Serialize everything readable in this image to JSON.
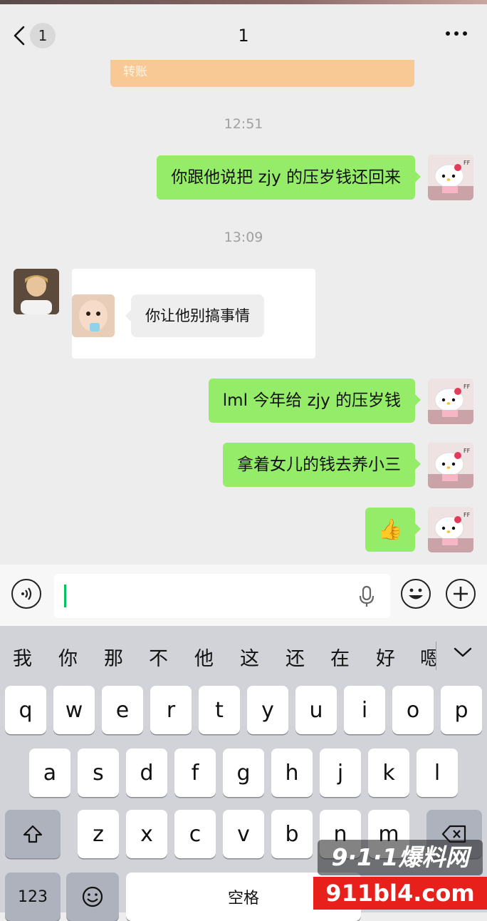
{
  "header": {
    "back_count": "1",
    "title": "1"
  },
  "transfer_card": {
    "label": "转账"
  },
  "messages": [
    {
      "time": "12:51"
    },
    {
      "from": "me",
      "text": "你跟他说把 zjy 的压岁钱还回来"
    },
    {
      "time": "13:09"
    },
    {
      "from": "other",
      "forwarded_text": "你让他别搞事情"
    },
    {
      "from": "me",
      "text": "lml 今年给 zjy 的压岁钱"
    },
    {
      "from": "me",
      "text": "拿着女儿的钱去养小三"
    },
    {
      "from": "me",
      "emoji": "👍"
    }
  ],
  "input": {
    "value": ""
  },
  "keyboard": {
    "candidates": [
      "我",
      "你",
      "那",
      "不",
      "他",
      "这",
      "还",
      "在",
      "好",
      "嗯"
    ],
    "row1": [
      "q",
      "w",
      "e",
      "r",
      "t",
      "y",
      "u",
      "i",
      "o",
      "p"
    ],
    "row2": [
      "a",
      "s",
      "d",
      "f",
      "g",
      "h",
      "j",
      "k",
      "l"
    ],
    "row3": [
      "z",
      "x",
      "c",
      "v",
      "b",
      "n",
      "m"
    ],
    "numbers_label": "123",
    "space_label": "空格"
  },
  "watermark": {
    "top": "9·1·1爆料网",
    "bottom": "911bl4.com"
  },
  "colors": {
    "sent_bubble": "#95ec69",
    "transfer": "#f8c895",
    "caret": "#07c160"
  }
}
